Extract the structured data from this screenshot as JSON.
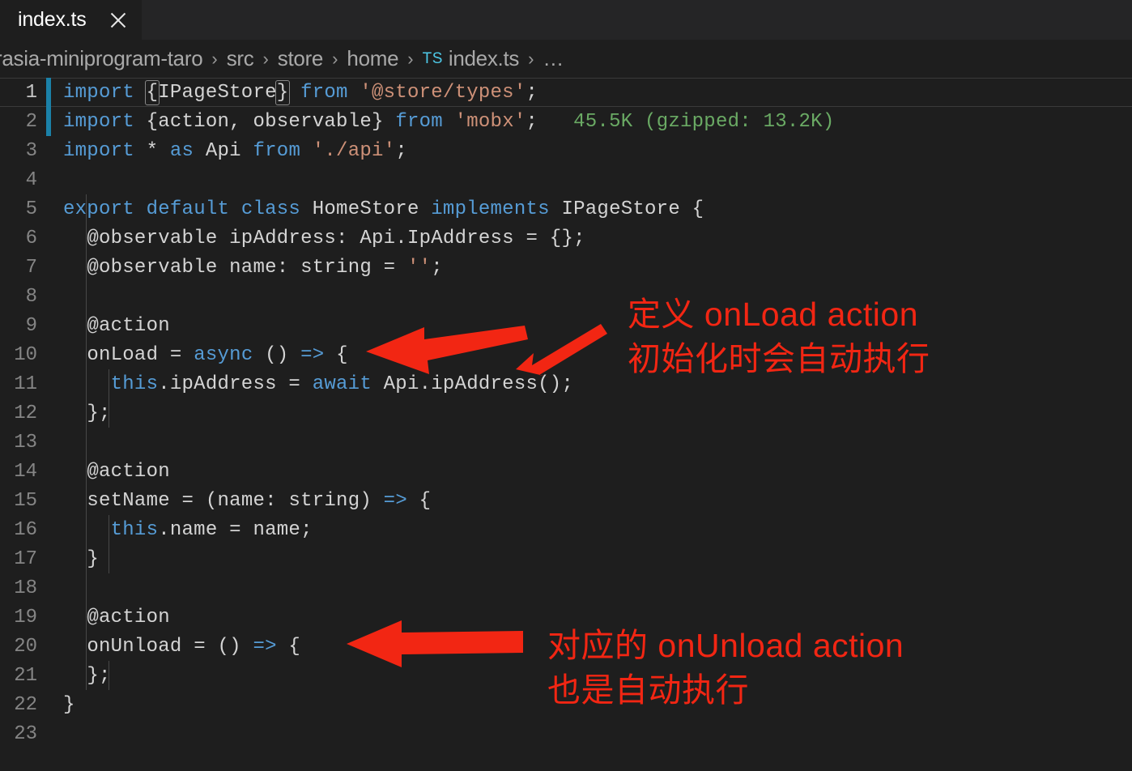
{
  "window": {
    "app": "code-editor",
    "background_color": "#1e1e1e",
    "tabbar_color": "#252526"
  },
  "tabbar": {
    "tabs": [
      {
        "label": "index.ts",
        "active": true,
        "close_icon": "close-icon"
      }
    ]
  },
  "breadcrumb": {
    "separator": "›",
    "items": [
      {
        "label": "rasia-miniprogram-taro",
        "badge": ""
      },
      {
        "label": "src",
        "badge": ""
      },
      {
        "label": "store",
        "badge": ""
      },
      {
        "label": "home",
        "badge": ""
      },
      {
        "label": "index.ts",
        "badge": "TS"
      },
      {
        "label": "…",
        "badge": ""
      }
    ]
  },
  "editor": {
    "language": "typescript",
    "gutter_git_color": "#1b81a8",
    "current_line": 1,
    "lines": [
      {
        "n": "1",
        "current": true,
        "git": true
      },
      {
        "n": "2",
        "current": false,
        "git": true
      },
      {
        "n": "3",
        "current": false,
        "git": false
      },
      {
        "n": "4",
        "current": false,
        "git": false
      },
      {
        "n": "5",
        "current": false,
        "git": false
      },
      {
        "n": "6",
        "current": false,
        "git": false
      },
      {
        "n": "7",
        "current": false,
        "git": false
      },
      {
        "n": "8",
        "current": false,
        "git": false
      },
      {
        "n": "9",
        "current": false,
        "git": false
      },
      {
        "n": "10",
        "current": false,
        "git": false
      },
      {
        "n": "11",
        "current": false,
        "git": false
      },
      {
        "n": "12",
        "current": false,
        "git": false
      },
      {
        "n": "13",
        "current": false,
        "git": false
      },
      {
        "n": "14",
        "current": false,
        "git": false
      },
      {
        "n": "15",
        "current": false,
        "git": false
      },
      {
        "n": "16",
        "current": false,
        "git": false
      },
      {
        "n": "17",
        "current": false,
        "git": false
      },
      {
        "n": "18",
        "current": false,
        "git": false
      },
      {
        "n": "19",
        "current": false,
        "git": false
      },
      {
        "n": "20",
        "current": false,
        "git": false
      },
      {
        "n": "21",
        "current": false,
        "git": false
      },
      {
        "n": "22",
        "current": false,
        "git": false
      },
      {
        "n": "23",
        "current": false,
        "git": false
      }
    ],
    "source_text": "import {IPageStore} from '@store/types';\nimport {action, observable} from 'mobx';\nimport * as Api from './api';\n\nexport default class HomeStore implements IPageStore {\n  @observable ipAddress: Api.IpAddress = {};\n  @observable name: string = '';\n\n  @action\n  onLoad = async () => {\n    this.ipAddress = await Api.ipAddress();\n  };\n\n  @action\n  setName = (name: string) => {\n    this.name = name;\n  }\n\n  @action\n  onUnload = () => {\n  };\n}\n",
    "inline_hints": [
      {
        "line": 2,
        "text": "45.5K (gzipped: 13.2K)",
        "color": "#6aaa64"
      }
    ],
    "theme_colors": {
      "keyword": "#569cd6",
      "string": "#ce9178",
      "identifier": "#d4d4d4",
      "line_number": "#858585",
      "line_number_active": "#c6c6c6"
    }
  },
  "annotations": {
    "color": "#f22613",
    "notes": [
      {
        "id": "note-onload",
        "text": "定义 onLoad action\n初始化时会自动执行"
      },
      {
        "id": "note-onunload",
        "text": "对应的 onUnload action\n也是自动执行"
      }
    ],
    "arrows": [
      {
        "id": "arrow-onload-thick",
        "points_to": "line-10",
        "style": "thick-left"
      },
      {
        "id": "arrow-onload-thin",
        "points_to": "line-11",
        "style": "thin-diagonal"
      },
      {
        "id": "arrow-onunload-thick",
        "points_to": "line-20",
        "style": "thick-left"
      }
    ]
  }
}
